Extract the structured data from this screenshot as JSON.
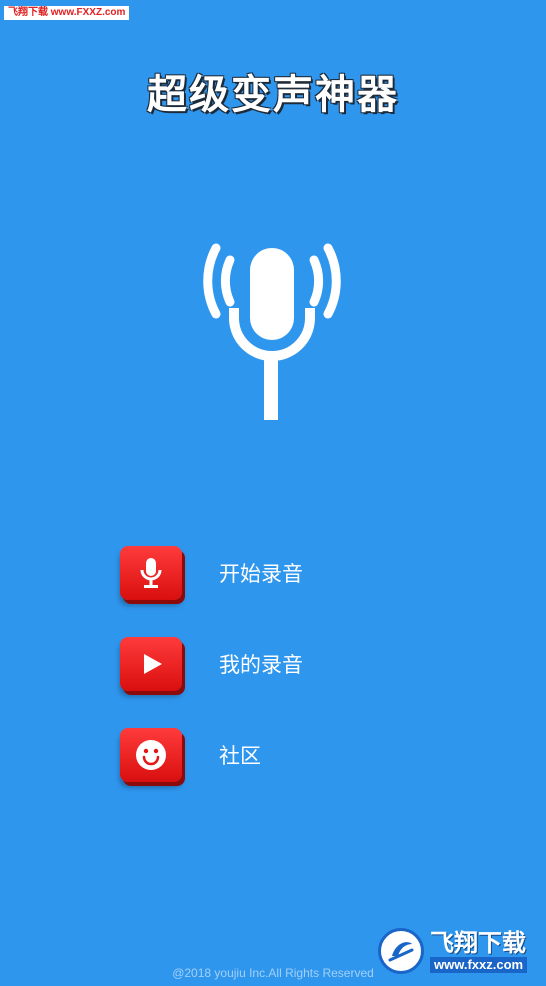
{
  "watermark_top": "飞翔下载 www.FXXZ.com",
  "app": {
    "title": "超级变声神器"
  },
  "hero": {
    "icon": "microphone-broadcast-icon"
  },
  "menu": [
    {
      "label": "开始录音",
      "icon": "microphone-icon"
    },
    {
      "label": "我的录音",
      "icon": "play-folder-icon"
    },
    {
      "label": "社区",
      "icon": "smiley-icon"
    }
  ],
  "footer": {
    "copyright": "@2018 youjiu Inc.All Rights Reserved"
  },
  "watermark_bottom": {
    "brand": "飞翔下载",
    "url": "www.fxxz.com"
  },
  "colors": {
    "background": "#2f96ee",
    "button_red": "#e61414",
    "text": "#ffffff"
  }
}
